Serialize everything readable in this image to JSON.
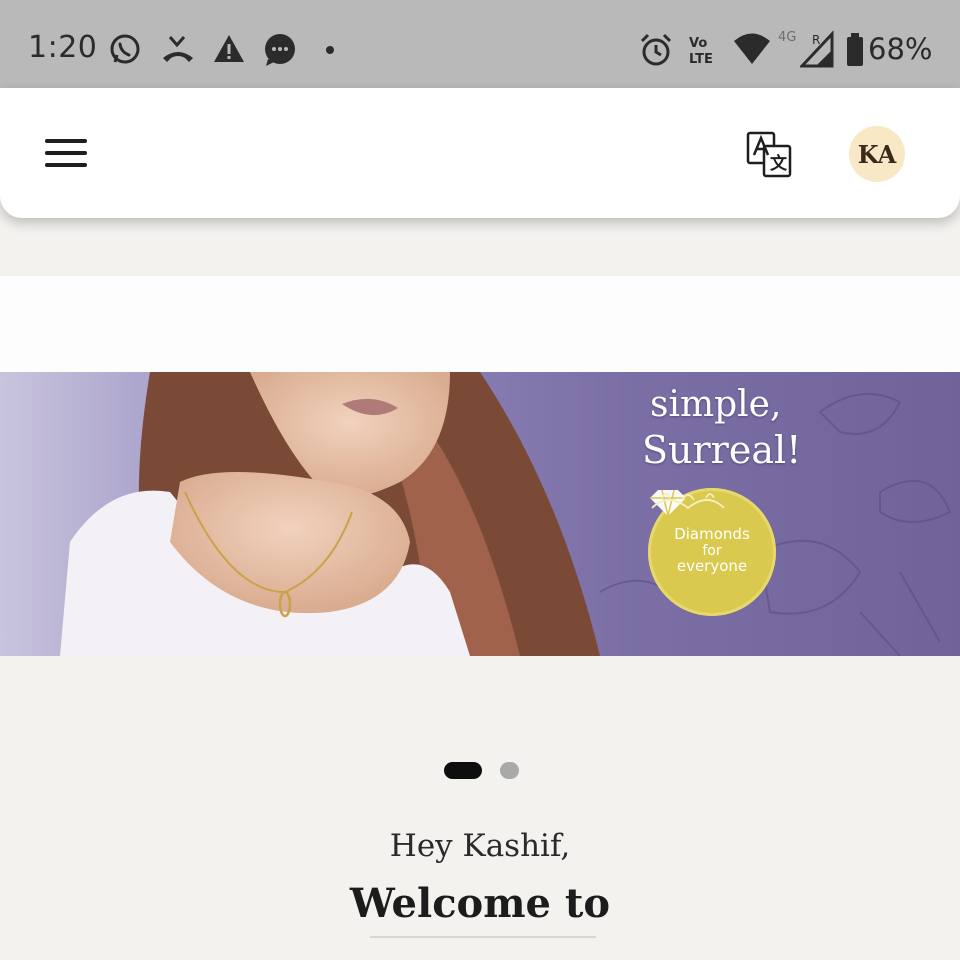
{
  "status_bar": {
    "time": "1:20",
    "battery": "68%",
    "network_label": "4G",
    "icons": [
      "whatsapp-icon",
      "missed-call-icon",
      "warning-icon",
      "message-icon",
      "dot-icon",
      "alarm-icon",
      "volte-icon",
      "wifi-icon",
      "signal-icon",
      "battery-icon"
    ]
  },
  "app_bar": {
    "menu_icon": "hamburger-menu-icon",
    "translate_icon": "translate-icon",
    "avatar_initials": "KA"
  },
  "banner": {
    "line1": "simple,",
    "line2": "Surreal!",
    "badge_line1": "Diamonds",
    "badge_line2": "for",
    "badge_line3": "everyone",
    "colors": {
      "background": "#7b6fa6",
      "badge": "#d9c94e"
    }
  },
  "carousel": {
    "total_slides": 2,
    "active_slide": 1
  },
  "greeting": {
    "hello": "Hey Kashif,",
    "welcome": "Welcome to"
  }
}
